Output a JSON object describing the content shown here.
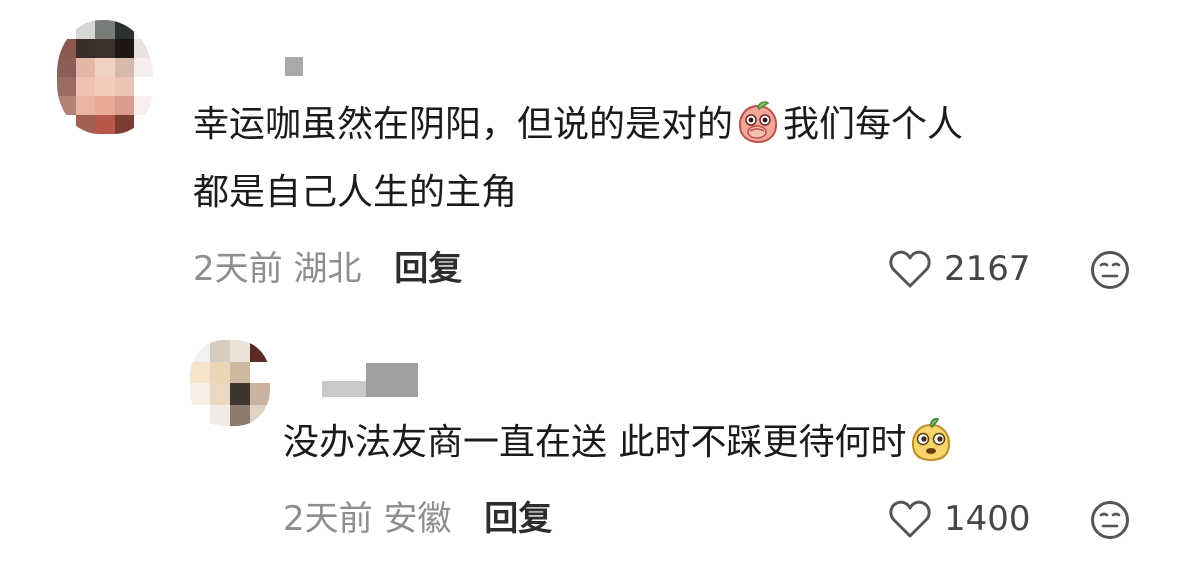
{
  "comments": [
    {
      "avatar_colors": [
        "#ffffff",
        "#d6d6d4",
        "#7a7e7b",
        "#2c302e",
        "#f3f0ee",
        "#8a5a52",
        "#3a2d2a",
        "#3e302b",
        "#1f1716",
        "#e8e2e0",
        "#8c5d57",
        "#e3b6a6",
        "#f1d2c3",
        "#d9b9ae",
        "#f6eeec",
        "#9a6a63",
        "#f0c2b1",
        "#f3ccbb",
        "#ecc4b6",
        "#ffffff",
        "#b18275",
        "#e8b6a2",
        "#eaa995",
        "#d89c8b",
        "#f7f0ee",
        "#ffffff",
        "#a26050",
        "#b7584a",
        "#7c3d33",
        "#fdfdfd"
      ],
      "text_lines": [
        [
          "幸运咖虽然在阴阳，但说的是对的",
          "我们每个人"
        ],
        [
          "都是自己人生的主角"
        ]
      ],
      "emoji": "peach-covering-mouth-emoji",
      "time": "2天前",
      "location": "湖北",
      "reply_label": "回复",
      "likes": "2167"
    },
    {
      "avatar_colors": [
        "#f3f1ef",
        "#d7ccc0",
        "#ece2d7",
        "#5b2a24",
        "#f5e3cc",
        "#ead6b7",
        "#cdb9a0",
        "#ffffff",
        "#f6efe6",
        "#ebd8c2",
        "#3e3531",
        "#c9b3a0",
        "#ffffff",
        "#f2ebe3",
        "#8c7a6c",
        "#e0d2c4"
      ],
      "text_lines": [
        [
          "没办法友商一直在送 此时不踩更待何时"
        ]
      ],
      "emoji": "sly-yellow-fruit-emoji",
      "time": "2天前",
      "location": "安徽",
      "reply_label": "回复",
      "likes": "1400"
    }
  ],
  "colors": {
    "text": "#1b1b1b",
    "meta": "#8e8e8e",
    "reply": "#2d2d2d",
    "icon": "#555555"
  },
  "icons": {
    "like": "heart-outline-icon",
    "react": "neutral-face-icon"
  }
}
